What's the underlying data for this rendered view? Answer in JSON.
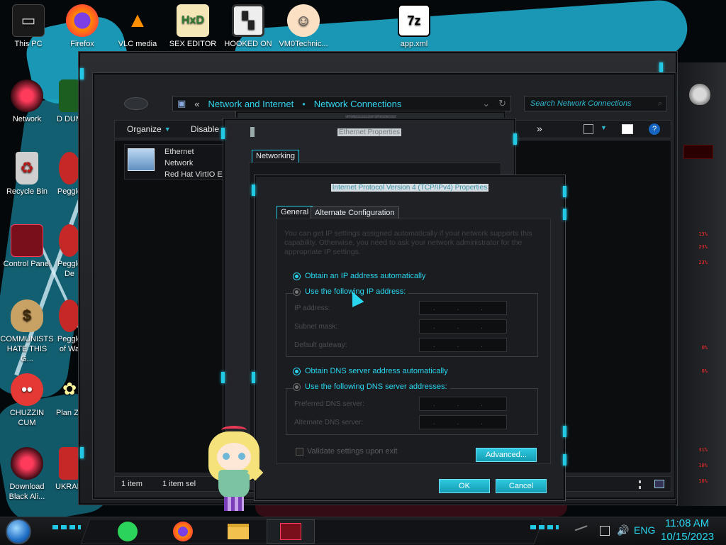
{
  "desktop": {
    "icons": [
      {
        "label": "This PC",
        "icon": "monitor-icon"
      },
      {
        "label": "Firefox",
        "icon": "firefox-icon"
      },
      {
        "label": "VLC media",
        "icon": "vlc-cone-icon"
      },
      {
        "label": "SEX EDITOR",
        "icon": "hxd-editor-icon"
      },
      {
        "label": "HOOKED ON",
        "icon": "maze-game-icon"
      },
      {
        "label": "VM0Technic...",
        "icon": "doctor-avatar-icon"
      },
      {
        "label": "app.xml",
        "icon": "7zip-icon"
      },
      {
        "label": "Network",
        "icon": "alien-network-icon"
      },
      {
        "label": "D DUM",
        "icon": "app-icon"
      },
      {
        "label": "Recycle Bin",
        "icon": "recycle-bin-icon"
      },
      {
        "label": "Peggle",
        "icon": "peggle-icon"
      },
      {
        "label": "Control Panel",
        "icon": "control-panel-icon"
      },
      {
        "label": "Peggle De",
        "icon": "peggle-icon"
      },
      {
        "label": "COMMUNISTS HATE THIS G...",
        "icon": "money-bag-icon"
      },
      {
        "label": "Peggle of Wa",
        "icon": "peggle-icon"
      },
      {
        "label": "CHUZZIN CUM",
        "icon": "chuzzle-icon"
      },
      {
        "label": "Plan Zo",
        "icon": "flower-icon"
      },
      {
        "label": "Download Black Ali...",
        "icon": "alien-download-icon"
      },
      {
        "label": "UKRAINE",
        "icon": "app-icon"
      }
    ]
  },
  "explorer": {
    "breadcrumb": {
      "back_glyph": "«",
      "part1": "Network and Internet",
      "sep": "•",
      "part2": "Network Connections"
    },
    "search_placeholder": "Search Network Connections",
    "toolbar": {
      "organize": "Organize",
      "disable": "Disable",
      "more": "»"
    },
    "connection": {
      "name": "Ethernet",
      "network": "Network",
      "adapter": "Red Hat VirtIO E"
    },
    "status_count": "1 item",
    "status_selected": "1 item sel"
  },
  "ethernet_status": {
    "title": "Ethernet Status"
  },
  "ethernet_props": {
    "title": "Ethernet Properties",
    "tab_networking": "Networking"
  },
  "ipv4": {
    "title": "Internet Protocol Version 4 (TCP/IPv4) Properties",
    "tabs": {
      "general": "General",
      "alternate": "Alternate Configuration"
    },
    "description": "You can get IP settings assigned automatically if your network supports this capability. Otherwise, you need to ask your network administrator for the appropriate IP settings.",
    "obtain_ip_auto": "Obtain an IP address automatically",
    "use_following_ip": "Use the following IP address:",
    "ip_address_label": "IP address:",
    "subnet_label": "Subnet mask:",
    "gateway_label": "Default gateway:",
    "obtain_dns_auto": "Obtain DNS server address automatically",
    "use_following_dns": "Use the following DNS server addresses:",
    "preferred_dns_label": "Preferred DNS server:",
    "alternate_dns_label": "Alternate DNS server:",
    "ip_dots": ". . .",
    "validate_label": "Validate settings upon exit",
    "advanced_button": "Advanced...",
    "ok_button": "OK",
    "cancel_button": "Cancel",
    "selected_ip_mode": "automatic",
    "selected_dns_mode": "automatic"
  },
  "gadget": {
    "stats": [
      "13%",
      "23%",
      "23%",
      "0%",
      "0%",
      "31%",
      "10%",
      "10%"
    ],
    "accent": "#ff2a2a"
  },
  "taskbar": {
    "pinned": [
      "start-orb-icon",
      "green-app-icon",
      "firefox-icon",
      "file-explorer-icon",
      "network-window-icon"
    ],
    "language": "ENG",
    "time": "11:08 AM",
    "date": "10/15/2023"
  },
  "theme": {
    "accent_cyan": "#21c9e4",
    "window_dark": "#1c1e21",
    "wallpaper_cyan": "#1da7c7"
  }
}
